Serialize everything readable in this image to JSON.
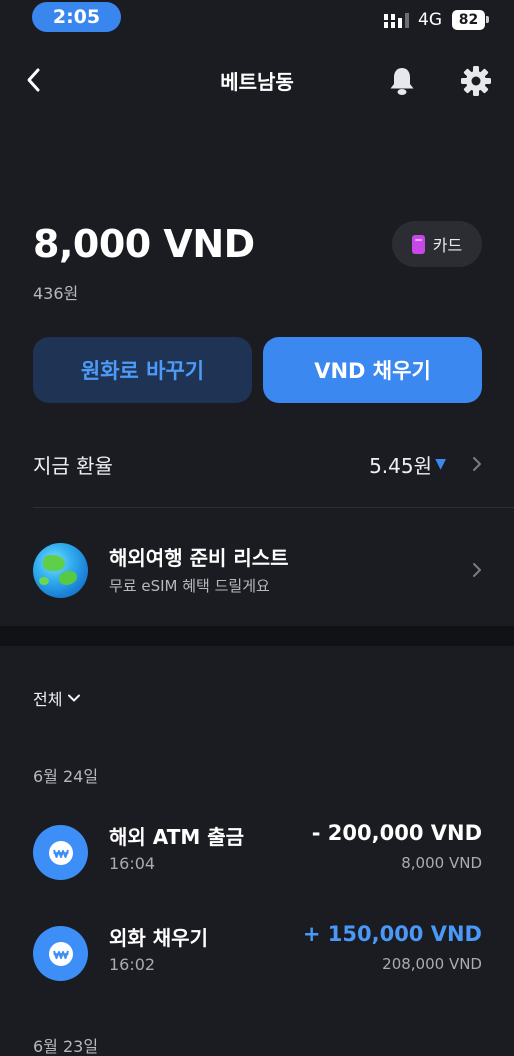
{
  "status": {
    "time": "2:05",
    "network": "4G",
    "battery": "82"
  },
  "nav": {
    "title": "베트남동"
  },
  "balance": {
    "amount": "8,000 VND",
    "krw": "436원",
    "card_label": "카드"
  },
  "actions": {
    "exchange_label": "원화로 바꾸기",
    "charge_label": "VND 채우기"
  },
  "rate": {
    "label": "지금 환율",
    "value": "5.45원",
    "trend_glyph": "▼"
  },
  "promo": {
    "title": "해외여행 준비 리스트",
    "subtitle": "무료 eSIM 혜택 드릴게요"
  },
  "filter": {
    "label": "전체"
  },
  "transactions": [
    {
      "date": "6월 24일",
      "items": [
        {
          "title": "해외 ATM 출금",
          "time": "16:04",
          "amount": "- 200,000 VND",
          "balance": "8,000 VND"
        },
        {
          "title": "외화 채우기",
          "time": "16:02",
          "amount": "+ 150,000 VND",
          "balance": "208,000 VND"
        }
      ]
    },
    {
      "date": "6월 23일",
      "items": []
    }
  ],
  "colors": {
    "accent": "#3b88f0",
    "background": "#1b1c21",
    "card_chip": "#c648e8"
  },
  "icons": {
    "back": "chevron-left-icon",
    "bell": "bell-icon",
    "gear": "gear-icon",
    "wallet": "won-coin-icon"
  }
}
